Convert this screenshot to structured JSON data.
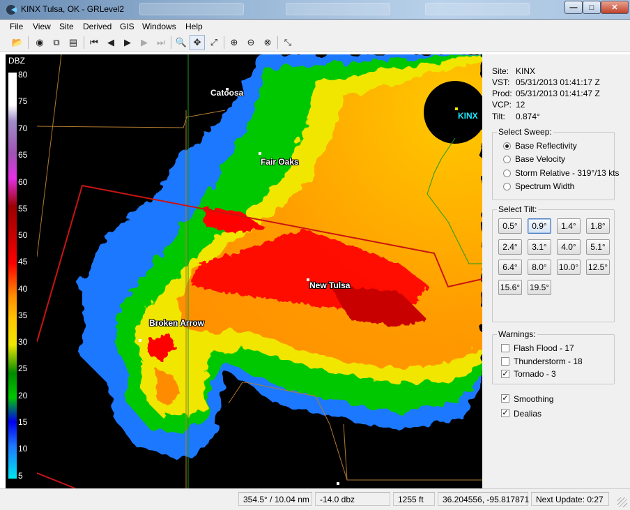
{
  "window": {
    "title": "KINX Tulsa, OK - GRLevel2",
    "minimize_glyph": "—",
    "maximize_glyph": "□",
    "close_glyph": "✕"
  },
  "menu": [
    "File",
    "View",
    "Site",
    "Derived",
    "GIS",
    "Windows",
    "Help"
  ],
  "toolbar": {
    "buttons": [
      "open-icon",
      "stop-icon",
      "copy-icon",
      "print-icon",
      "skip-first-icon",
      "step-back-icon",
      "play-icon",
      "step-forward-icon",
      "skip-last-icon",
      "zoom-icon",
      "pan-icon",
      "measure-icon",
      "zoom-in-icon",
      "zoom-out-icon",
      "zoom-reset-icon",
      "sample-icon"
    ],
    "glyphs": [
      "📂",
      "◉",
      "⧉",
      "▤",
      "⏮",
      "◀",
      "▶",
      "▶",
      "⏭",
      "🔍",
      "✥",
      "⤢",
      "⊕",
      "⊖",
      "⊗",
      "⤡"
    ]
  },
  "legend": {
    "title": "DBZ",
    "labels": [
      "80",
      "75",
      "70",
      "65",
      "60",
      "55",
      "50",
      "45",
      "40",
      "35",
      "30",
      "25",
      "20",
      "15",
      "10",
      "5"
    ]
  },
  "map": {
    "towns": [
      "Catoosa",
      "Fair Oaks",
      "New Tulsa",
      "Broken Arrow"
    ],
    "site": "KINX"
  },
  "info": {
    "site_key": "Site:",
    "site": "KINX",
    "vst_key": "VST:",
    "vst": "05/31/2013  01:41:17 Z",
    "prod_key": "Prod:",
    "prod": "05/31/2013  01:41:47 Z",
    "vcp_key": "VCP:",
    "vcp": "12",
    "tilt_key": "Tilt:",
    "tilt": "0.874°"
  },
  "sweep": {
    "title": "Select Sweep:",
    "options": [
      "Base Reflectivity",
      "Base Velocity",
      "Storm Relative - 319°/13 kts",
      "Spectrum Width"
    ],
    "selected": "Base Reflectivity"
  },
  "tilt": {
    "title": "Select Tilt:",
    "options": [
      "0.5°",
      "0.9°",
      "1.4°",
      "1.8°",
      "2.4°",
      "3.1°",
      "4.0°",
      "5.1°",
      "6.4°",
      "8.0°",
      "10.0°",
      "12.5°",
      "15.6°",
      "19.5°"
    ],
    "selected": "0.9°"
  },
  "warnings": {
    "title": "Warnings:",
    "items": [
      {
        "label": "Flash Flood - 17",
        "checked": false
      },
      {
        "label": "Thunderstorm - 18",
        "checked": false
      },
      {
        "label": "Tornado - 3",
        "checked": true
      }
    ]
  },
  "options": {
    "smoothing": {
      "label": "Smoothing",
      "checked": true
    },
    "dealias": {
      "label": "Dealias",
      "checked": true
    }
  },
  "status": {
    "bearing": "354.5° / 10.04 nm",
    "value": "-14.0 dbz",
    "height": "1255 ft",
    "coords": "36.204556, -95.817871",
    "next_update": "Next Update: 0:27"
  },
  "colors": {
    "radar_bg": "#000000",
    "warning_polygon": "#c81414",
    "county_line": "#b07a30",
    "city_line": "#1e9a1e",
    "site_label": "#1ee6ff"
  }
}
